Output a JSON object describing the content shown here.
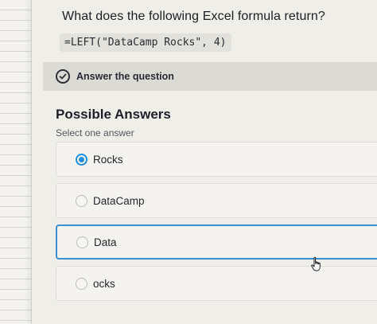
{
  "question": {
    "text": "What does the following Excel formula return?",
    "formula": "=LEFT(\"DataCamp Rocks\", 4)"
  },
  "answer_bar": {
    "label": "Answer the question",
    "icon": "check-circle-icon"
  },
  "answers": {
    "title": "Possible Answers",
    "subtitle": "Select one answer",
    "options": [
      {
        "label": "Rocks",
        "selected": true
      },
      {
        "label": "DataCamp",
        "selected": false
      },
      {
        "label": "Data",
        "selected": false,
        "focused": true
      },
      {
        "label": "ocks",
        "selected": false
      }
    ]
  },
  "colors": {
    "accent": "#1f8fe0",
    "focus_border": "#3a8fd1"
  },
  "cursor": {
    "icon": "hand-pointer-icon"
  }
}
